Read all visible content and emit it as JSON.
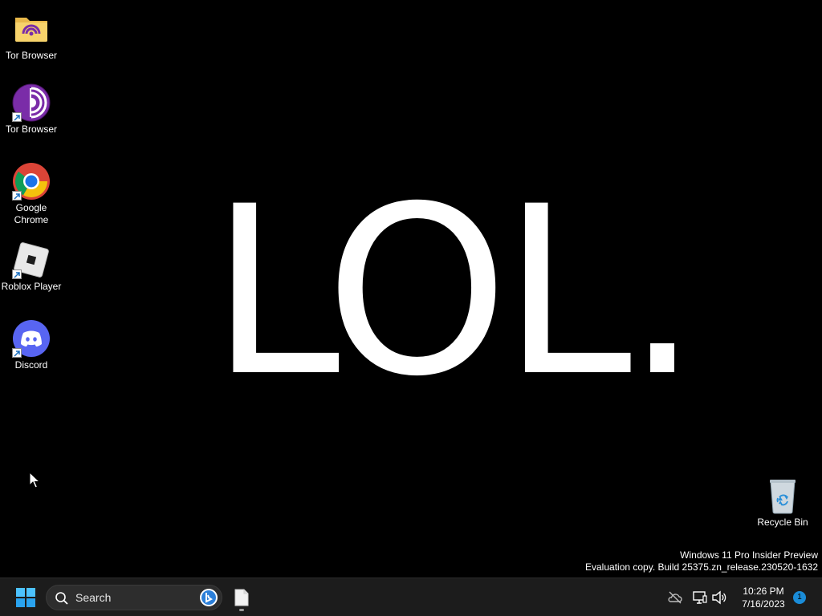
{
  "desktop": {
    "wallpaper_text": "LOL.",
    "icons": [
      {
        "label": "Tor Browser",
        "icon": "folder-icon"
      },
      {
        "label": "Tor Browser",
        "icon": "tor-browser-icon"
      },
      {
        "label": "Google Chrome",
        "icon": "chrome-icon"
      },
      {
        "label": "Roblox Player",
        "icon": "roblox-icon"
      },
      {
        "label": "Discord",
        "icon": "discord-icon"
      },
      {
        "label": "Recycle Bin",
        "icon": "recycle-bin-icon"
      }
    ],
    "watermark": {
      "line1": "Windows 11 Pro Insider Preview",
      "line2": "Evaluation copy. Build 25375.zn_release.230520-1632"
    }
  },
  "taskbar": {
    "start_icon": "windows-start-icon",
    "search": {
      "label": "Search",
      "icon": "search-icon",
      "badge_icon": "bing-icon"
    },
    "pinned_apps": [
      {
        "icon": "file-icon",
        "running": true
      }
    ],
    "tray": {
      "icons": [
        "onedrive-offline-icon",
        "network-icon",
        "volume-icon"
      ],
      "time": "10:26 PM",
      "date": "7/16/2023",
      "notification_count": "1"
    }
  },
  "colors": {
    "desktop_bg": "#000000",
    "taskbar_bg": "#1c1c1c",
    "accent": "#1a8cd8",
    "discord": "#5865f2",
    "tor": "#7a2ca8"
  }
}
